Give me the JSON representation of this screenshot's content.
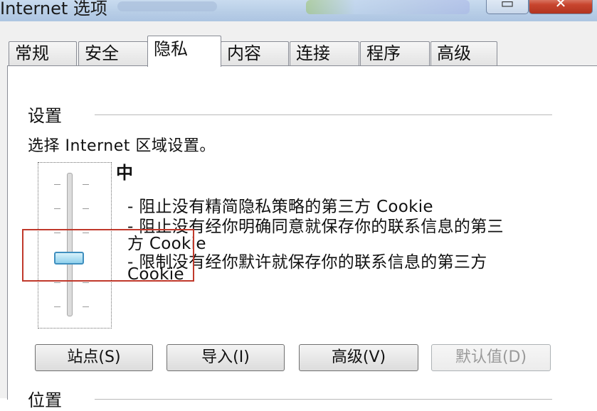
{
  "window": {
    "title": "Internet 选项",
    "maximize_glyph": "▭",
    "close_glyph": "✕"
  },
  "tabs": [
    {
      "label": "常规"
    },
    {
      "label": "安全"
    },
    {
      "label": "隐私"
    },
    {
      "label": "内容"
    },
    {
      "label": "连接"
    },
    {
      "label": "程序"
    },
    {
      "label": "高级"
    }
  ],
  "active_tab": "隐私",
  "settings": {
    "group_label": "设置",
    "description": "选择 Internet 区域设置。",
    "level": "中",
    "bullets": [
      "- 阻止没有精简隐私策略的第三方 Cookie",
      "- 阻止没有经你明确同意就保存你的联系信息的第三",
      "方 Cookie",
      "- 限制没有经你默许就保存你的联系信息的第三方",
      "Cookie"
    ]
  },
  "buttons": {
    "sites": "站点(S)",
    "import": "导入(I)",
    "advanced": "高级(V)",
    "default": "默认值(D)"
  },
  "location": {
    "group_label": "位置"
  },
  "colors": {
    "highlight": "#c0392b",
    "slider_thumb": "#8fd0ec"
  }
}
